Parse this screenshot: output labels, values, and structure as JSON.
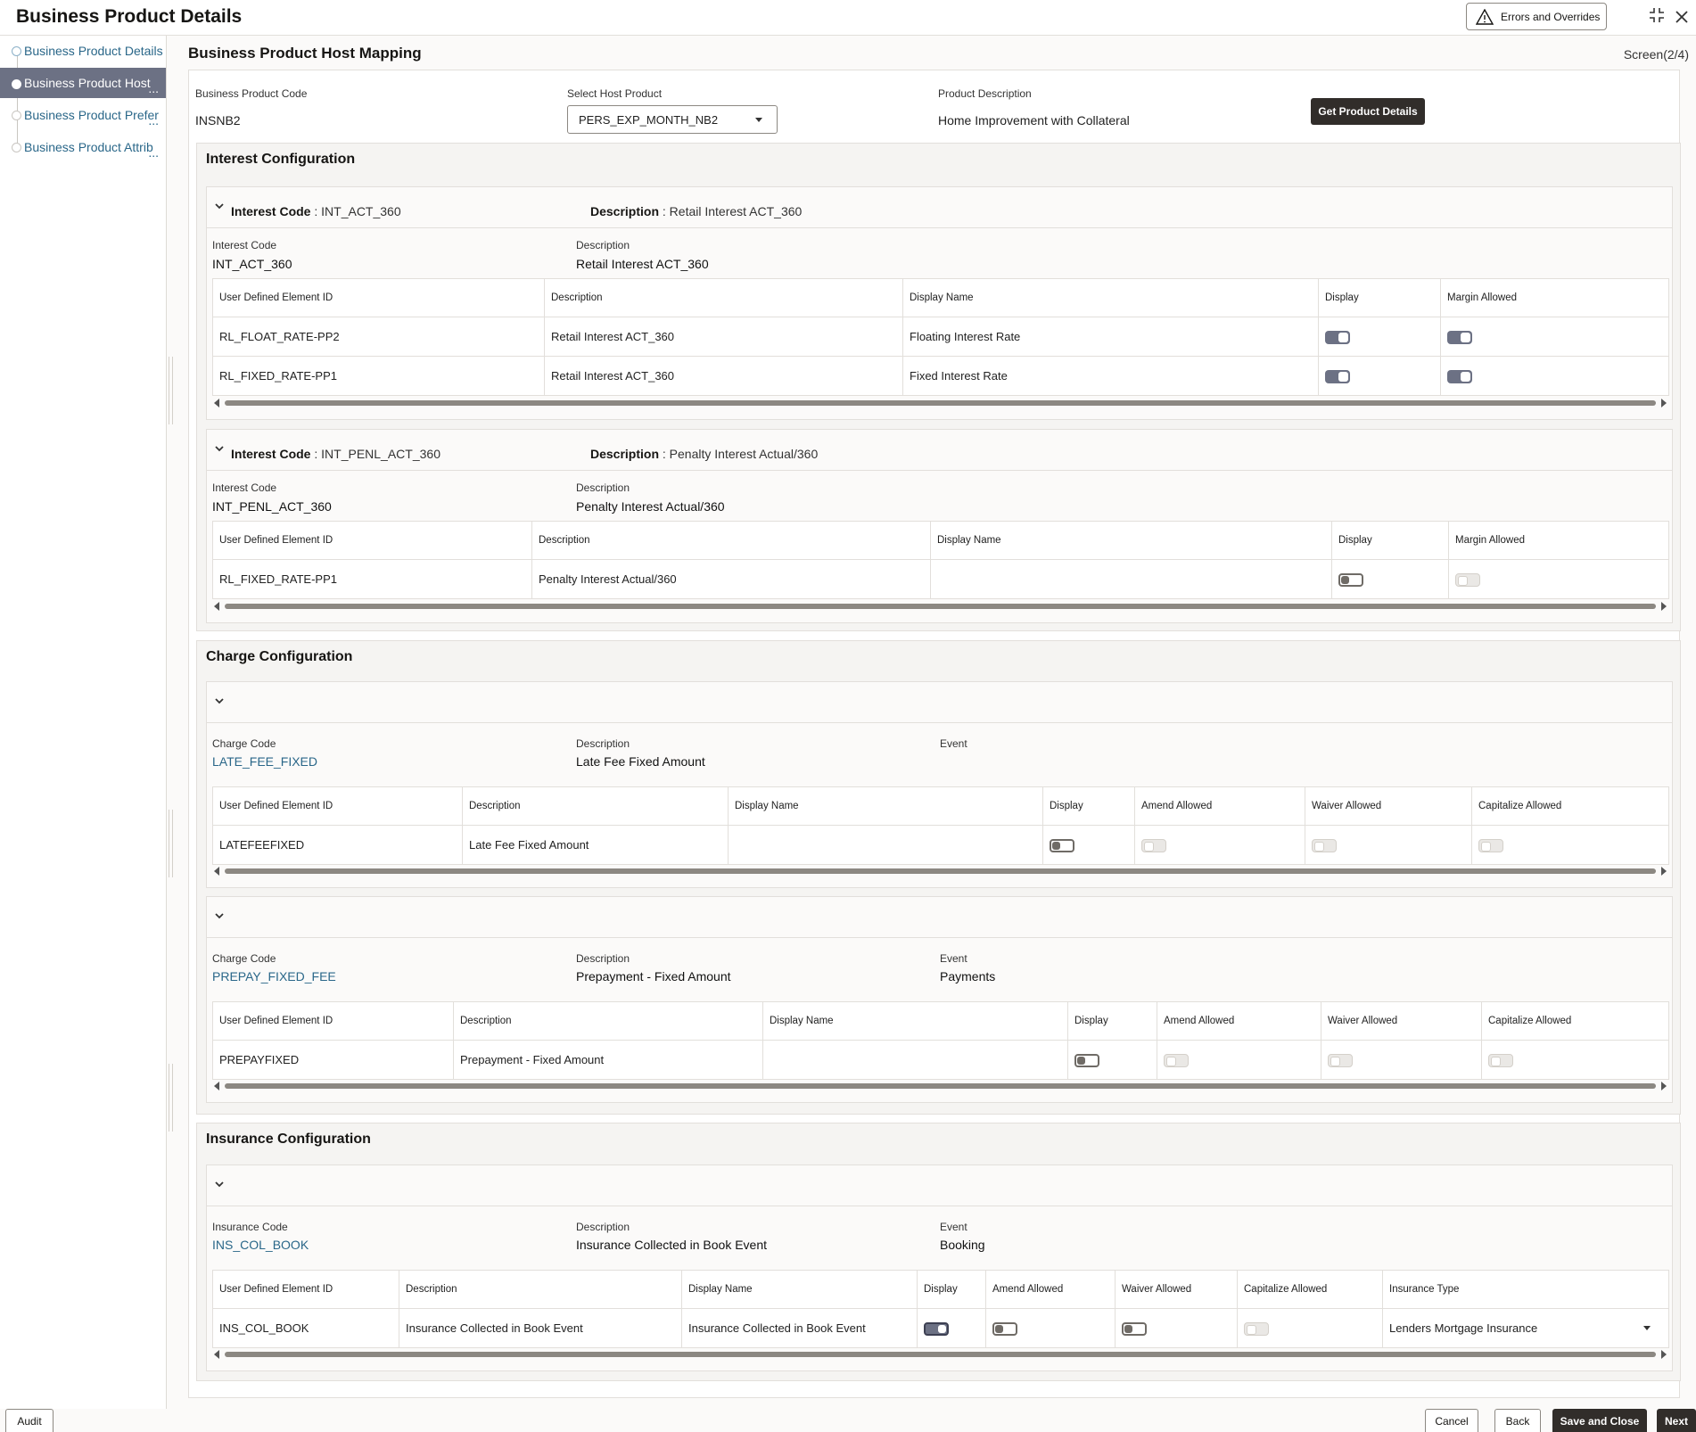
{
  "header": {
    "title": "Business Product Details",
    "errors_label": "Errors and Overrides"
  },
  "sidebar": {
    "items": [
      {
        "label": "Business Product Details",
        "state": "done"
      },
      {
        "label": "Business Product Host",
        "state": "current"
      },
      {
        "label": "Business Product Prefer",
        "state": "pending"
      },
      {
        "label": "Business Product Attrib",
        "state": "pending"
      }
    ],
    "ellipsis": "..."
  },
  "main": {
    "title": "Business Product Host Mapping",
    "screen": "Screen(2/4)",
    "product_code_label": "Business Product Code",
    "product_code": "INSNB2",
    "host_product_label": "Select Host Product",
    "host_product": "PERS_EXP_MONTH_NB2",
    "product_desc_label": "Product Description",
    "product_desc": "Home Improvement with Collateral",
    "get_details_label": "Get Product Details"
  },
  "interest": {
    "title": "Interest Configuration",
    "cards": [
      {
        "head_code_label": "Interest Code",
        "head_code": " : INT_ACT_360",
        "head_desc_label": "Description",
        "head_desc": " : Retail Interest ACT_360",
        "code_label": "Interest Code",
        "code": "INT_ACT_360",
        "desc_label": "Description",
        "desc": "Retail Interest ACT_360",
        "columns": [
          "User Defined Element ID",
          "Description",
          "Display Name",
          "Display",
          "Margin Allowed"
        ],
        "rows": [
          {
            "id": "RL_FLOAT_RATE-PP2",
            "desc": "Retail Interest ACT_360",
            "display_name": "Floating Interest Rate",
            "display": "on",
            "margin": "on"
          },
          {
            "id": "RL_FIXED_RATE-PP1",
            "desc": "Retail Interest ACT_360",
            "display_name": "Fixed Interest Rate",
            "display": "on",
            "margin": "on"
          }
        ]
      },
      {
        "head_code_label": "Interest Code",
        "head_code": " : INT_PENL_ACT_360",
        "head_desc_label": "Description",
        "head_desc": " : Penalty Interest Actual/360",
        "code_label": "Interest Code",
        "code": "INT_PENL_ACT_360",
        "desc_label": "Description",
        "desc": "Penalty Interest Actual/360",
        "columns": [
          "User Defined Element ID",
          "Description",
          "Display Name",
          "Display",
          "Margin Allowed"
        ],
        "rows": [
          {
            "id": "RL_FIXED_RATE-PP1",
            "desc": "Penalty Interest Actual/360",
            "display_name": "",
            "display": "off",
            "margin": "disabled"
          }
        ]
      }
    ]
  },
  "charge": {
    "title": "Charge Configuration",
    "cards": [
      {
        "code_label": "Charge Code",
        "code": "LATE_FEE_FIXED",
        "desc_label": "Description",
        "desc": "Late Fee Fixed Amount",
        "event_label": "Event",
        "event": "",
        "columns": [
          "User Defined Element ID",
          "Description",
          "Display Name",
          "Display",
          "Amend Allowed",
          "Waiver Allowed",
          "Capitalize Allowed"
        ],
        "rows": [
          {
            "id": "LATEFEEFIXED",
            "desc": "Late Fee Fixed Amount",
            "display_name": "",
            "display": "off",
            "amend": "disabled",
            "waiver": "disabled",
            "capitalize": "disabled"
          }
        ]
      },
      {
        "code_label": "Charge Code",
        "code": "PREPAY_FIXED_FEE",
        "desc_label": "Description",
        "desc": "Prepayment - Fixed Amount",
        "event_label": "Event",
        "event": "Payments",
        "columns": [
          "User Defined Element ID",
          "Description",
          "Display Name",
          "Display",
          "Amend Allowed",
          "Waiver Allowed",
          "Capitalize Allowed"
        ],
        "rows": [
          {
            "id": "PREPAYFIXED",
            "desc": "Prepayment - Fixed Amount",
            "display_name": "",
            "display": "off",
            "amend": "disabled",
            "waiver": "disabled",
            "capitalize": "disabled"
          }
        ]
      }
    ]
  },
  "insurance": {
    "title": "Insurance Configuration",
    "card": {
      "code_label": "Insurance Code",
      "code": "INS_COL_BOOK",
      "desc_label": "Description",
      "desc": "Insurance Collected in Book Event",
      "event_label": "Event",
      "event": "Booking",
      "columns": [
        "User Defined Element ID",
        "Description",
        "Display Name",
        "Display",
        "Amend Allowed",
        "Waiver Allowed",
        "Capitalize Allowed",
        "Insurance Type"
      ],
      "rows": [
        {
          "id": "INS_COL_BOOK",
          "desc": "Insurance Collected in Book Event",
          "display_name": "Insurance Collected in Book Event",
          "display": "on",
          "amend": "off",
          "waiver": "off",
          "capitalize": "disabled",
          "insurance_type": "Lenders Mortgage Insurance"
        }
      ]
    }
  },
  "footer": {
    "audit": "Audit",
    "cancel": "Cancel",
    "back": "Back",
    "save_close": "Save and Close",
    "next": "Next"
  },
  "icons": {
    "warning": "warning-triangle-icon",
    "maximize": "maximize-icon",
    "close": "close-icon",
    "chevron": "chevron-down-icon",
    "check": "check-icon"
  },
  "colors": {
    "accent": "#6c7184",
    "link": "#2a6789",
    "dark_button": "#312d2a"
  }
}
